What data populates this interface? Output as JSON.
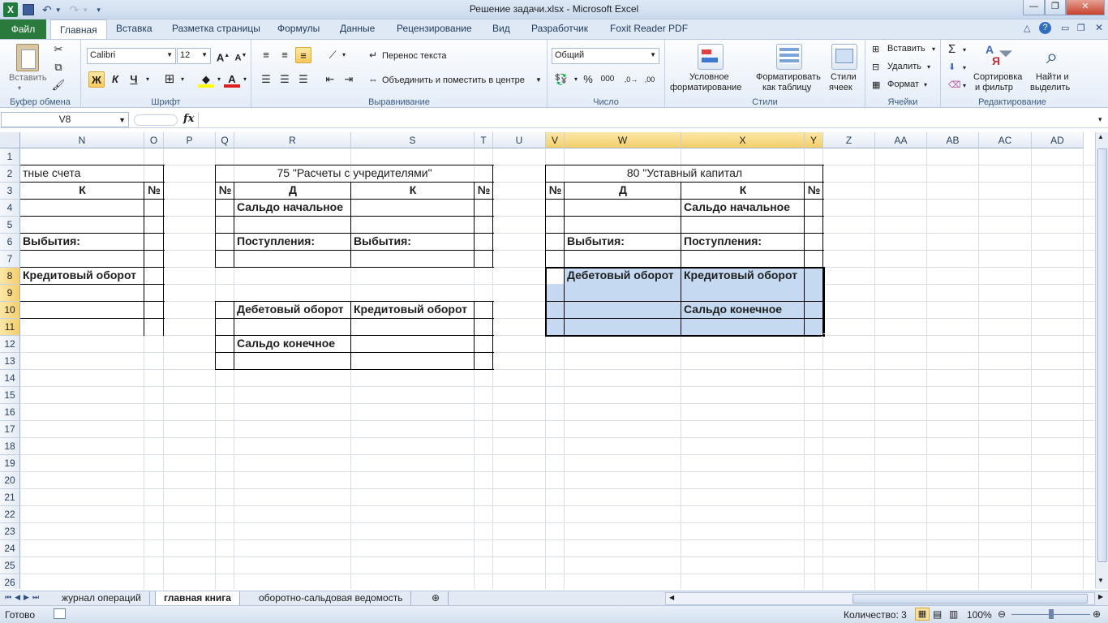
{
  "window": {
    "title": "Решение задачи.xlsx  -  Microsoft Excel",
    "minimize": "—",
    "maximize": "❐",
    "close": "✕"
  },
  "ribbon_tabs": [
    "Файл",
    "Главная",
    "Вставка",
    "Разметка страницы",
    "Формулы",
    "Данные",
    "Рецензирование",
    "Вид",
    "Разработчик",
    "Foxit Reader PDF"
  ],
  "ribbon": {
    "clipboard": {
      "paste": "Вставить",
      "label": "Буфер обмена"
    },
    "font": {
      "name": "Calibri",
      "size": "12",
      "bold": "Ж",
      "italic": "К",
      "underline": "Ч",
      "label": "Шрифт"
    },
    "alignment": {
      "wrap": "Перенос текста",
      "merge": "Объединить и поместить в центре",
      "label": "Выравнивание"
    },
    "number": {
      "format": "Общий",
      "percent": "%",
      "thousands": "000",
      "label": "Число"
    },
    "styles": {
      "conditional": "Условное форматирование",
      "cond_line1": "Условное",
      "cond_line2": "форматирование",
      "table_line1": "Форматировать",
      "table_line2": "как таблицу",
      "cell_line1": "Стили",
      "cell_line2": "ячеек",
      "label": "Стили"
    },
    "cells": {
      "insert": "Вставить",
      "delete": "Удалить",
      "format": "Формат",
      "label": "Ячейки"
    },
    "editing": {
      "sort_line1": "Сортировка",
      "sort_line2": "и фильтр",
      "find_line1": "Найти и",
      "find_line2": "выделить",
      "label": "Редактирование"
    }
  },
  "formula_bar": {
    "name_box": "V8",
    "fx": "fx",
    "value": ""
  },
  "columns": [
    "N",
    "O",
    "P",
    "Q",
    "R",
    "S",
    "T",
    "U",
    "V",
    "W",
    "X",
    "Y",
    "Z",
    "AA",
    "AB",
    "AC",
    "AD"
  ],
  "rows": [
    "1",
    "2",
    "3",
    "4",
    "5",
    "6",
    "7",
    "8",
    "9",
    "10",
    "11",
    "12",
    "13",
    "14",
    "15",
    "16",
    "17",
    "18",
    "19",
    "20",
    "21",
    "22",
    "23",
    "24",
    "25",
    "26"
  ],
  "cells": {
    "n2": "тные счета",
    "n3": "К",
    "o3": "№",
    "n6": "Выбытия:",
    "n8": "Кредитовый оборот",
    "r2": "75 \"Расчеты с учредителями\"",
    "q3": "№",
    "r3": "Д",
    "s3": "К",
    "t3": "№",
    "r4": "Сальдо начальное",
    "r6": "Поступления:",
    "s6": "Выбытия:",
    "r10": "Дебетовый оборот",
    "s10": "Кредитовый оборот",
    "r12": "Сальдо конечное",
    "w2": "80 \"Уставный капитал",
    "v3": "№",
    "w3": "Д",
    "x3": "К",
    "y3": "№",
    "x4": "Сальдо начальное",
    "w6": "Выбытия:",
    "x6": "Поступления:",
    "w8": "Дебетовый оборот",
    "x8": "Кредитовый оборот",
    "x10": "Сальдо конечное"
  },
  "sheets": [
    "журнал операций",
    "главная книга",
    "оборотно-сальдовая ведомость"
  ],
  "status": {
    "ready": "Готово",
    "count": "Количество: 3",
    "zoom": "100%"
  }
}
